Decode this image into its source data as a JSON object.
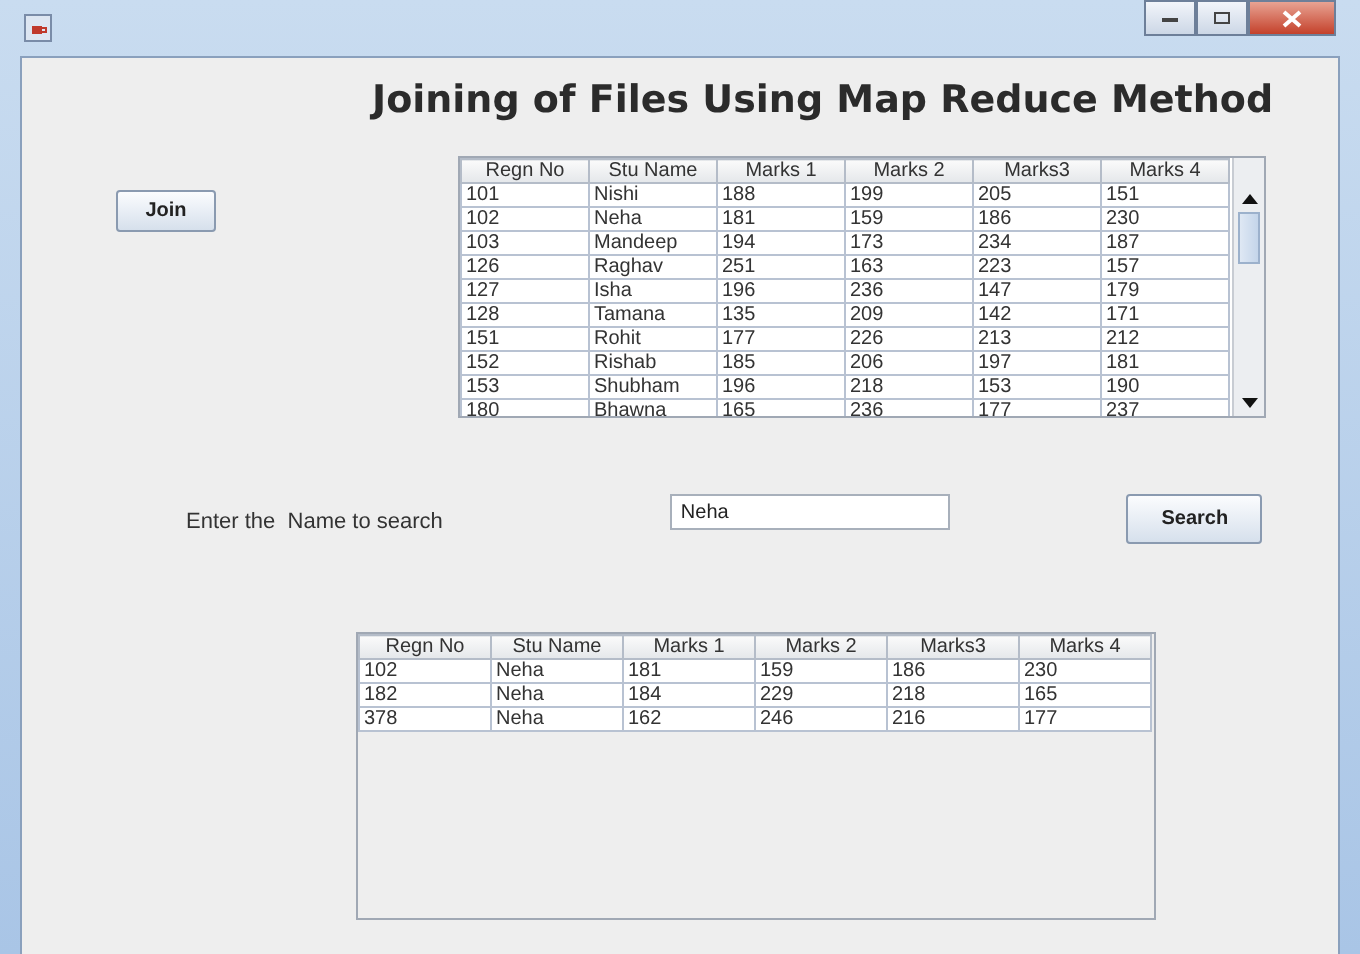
{
  "heading": "Joining of Files Using Map Reduce Method",
  "join_button": "Join",
  "records_table": {
    "columns": [
      "Regn No",
      "Stu Name",
      "Marks 1",
      "Marks 2",
      "Marks3",
      "Marks 4"
    ],
    "rows": [
      [
        "101",
        "Nishi",
        "188",
        "199",
        "205",
        "151"
      ],
      [
        "102",
        "Neha",
        "181",
        "159",
        "186",
        "230"
      ],
      [
        "103",
        "Mandeep",
        "194",
        "173",
        "234",
        "187"
      ],
      [
        "126",
        "Raghav",
        "251",
        "163",
        "223",
        "157"
      ],
      [
        "127",
        "Isha",
        "196",
        "236",
        "147",
        "179"
      ],
      [
        "128",
        "Tamana",
        "135",
        "209",
        "142",
        "171"
      ],
      [
        "151",
        "Rohit",
        "177",
        "226",
        "213",
        "212"
      ],
      [
        "152",
        "Rishab",
        "185",
        "206",
        "197",
        "181"
      ],
      [
        "153",
        "Shubham",
        "196",
        "218",
        "153",
        "190"
      ],
      [
        "180",
        "Bhawna",
        "165",
        "236",
        "177",
        "237"
      ]
    ]
  },
  "search": {
    "label": "Enter the  Name to search",
    "value": "Neha",
    "button": "Search"
  },
  "results_table": {
    "columns": [
      "Regn No",
      "Stu Name",
      "Marks 1",
      "Marks 2",
      "Marks3",
      "Marks 4"
    ],
    "rows": [
      [
        "102",
        "Neha",
        "181",
        "159",
        "186",
        "230"
      ],
      [
        "182",
        "Neha",
        "184",
        "229",
        "218",
        "165"
      ],
      [
        "378",
        "Neha",
        "162",
        "246",
        "216",
        "177"
      ]
    ]
  }
}
